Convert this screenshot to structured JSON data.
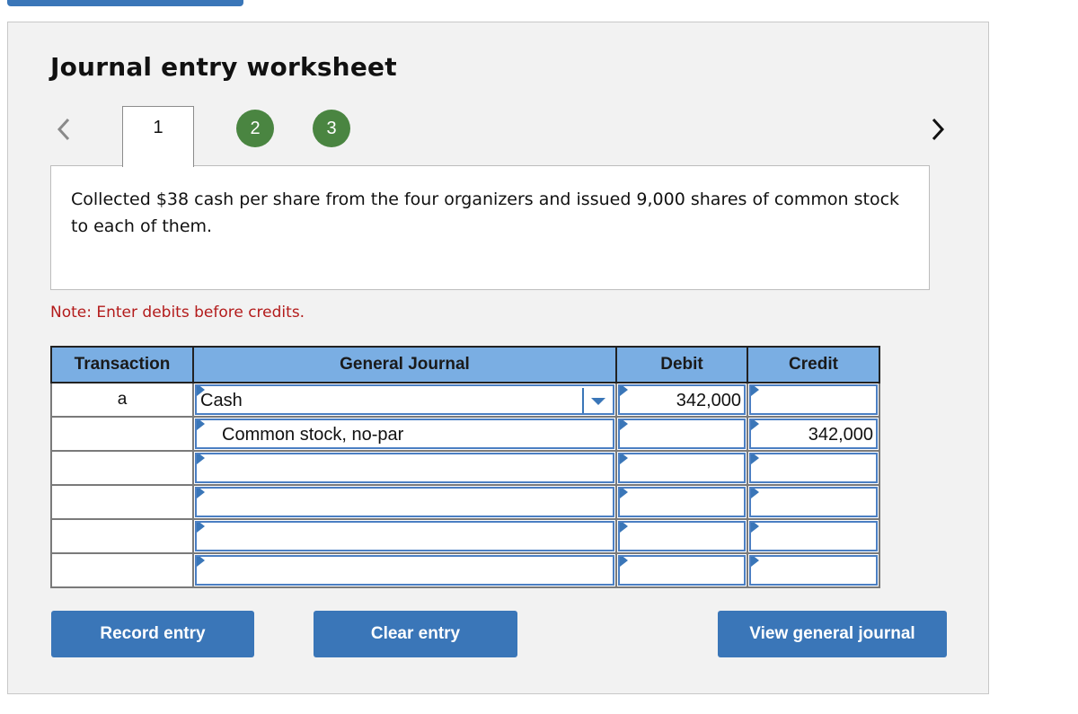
{
  "top_button": {
    "label": ""
  },
  "worksheet": {
    "title": "Journal entry worksheet",
    "nav": {
      "prev_icon": "chevron-left-icon",
      "next_icon": "chevron-right-icon"
    },
    "tabs": [
      {
        "label": "1",
        "state": "active"
      },
      {
        "label": "2",
        "state": "completed"
      },
      {
        "label": "3",
        "state": "completed"
      }
    ],
    "description": "Collected $38 cash per share from the four organizers and issued 9,000 shares of common stock to each of them.",
    "note": "Note: Enter debits before credits."
  },
  "table": {
    "headers": {
      "transaction": "Transaction",
      "general_journal": "General Journal",
      "debit": "Debit",
      "credit": "Credit"
    },
    "rows": [
      {
        "transaction": "a",
        "account": "Cash",
        "indent": false,
        "debit": "342,000",
        "credit": "",
        "has_dropdown": true
      },
      {
        "transaction": "",
        "account": "Common stock, no-par",
        "indent": true,
        "debit": "",
        "credit": "342,000",
        "has_dropdown": false
      },
      {
        "transaction": "",
        "account": "",
        "indent": false,
        "debit": "",
        "credit": "",
        "has_dropdown": false
      },
      {
        "transaction": "",
        "account": "",
        "indent": false,
        "debit": "",
        "credit": "",
        "has_dropdown": false
      },
      {
        "transaction": "",
        "account": "",
        "indent": false,
        "debit": "",
        "credit": "",
        "has_dropdown": false
      },
      {
        "transaction": "",
        "account": "",
        "indent": false,
        "debit": "",
        "credit": "",
        "has_dropdown": false
      }
    ]
  },
  "buttons": {
    "record": "Record entry",
    "clear": "Clear entry",
    "view": "View general journal"
  },
  "colors": {
    "accent_blue": "#3a76b8",
    "header_blue": "#7aaee3",
    "tab_green": "#4a8541",
    "note_red": "#b31b1b",
    "panel_bg": "#f2f2f2"
  }
}
